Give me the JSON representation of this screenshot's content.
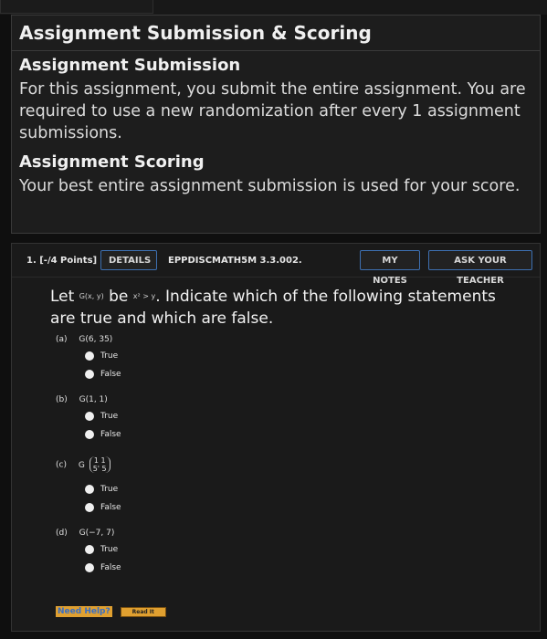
{
  "panel": {
    "title": "Assignment Submission & Scoring",
    "submission_heading": "Assignment Submission",
    "submission_text": "For this assignment, you submit the entire assignment. You are required to use a new randomization after every 1 assignment submissions.",
    "scoring_heading": "Assignment Scoring",
    "scoring_text": "Your best entire assignment submission is used for your score."
  },
  "question": {
    "number": "1. [-/4 Points]",
    "details_label": "DETAILS",
    "code": "EPPDISCMATH5M 3.3.002.",
    "notes_label": "MY NOTES",
    "ask_label": "ASK YOUR TEACHER",
    "stem_let": "Let",
    "stem_gxy": "G(x, y)",
    "stem_be": "be",
    "stem_cond": "x² > y",
    "stem_rest": ". Indicate which of the following statements are true and which are false.",
    "parts": [
      {
        "label": "(a)",
        "expr": "G(6, 35)"
      },
      {
        "label": "(b)",
        "expr": "G(1, 1)"
      },
      {
        "label": "(c)",
        "expr_prefix": "G",
        "m_top": "1  1",
        "m_bottom": "5' 5"
      },
      {
        "label": "(d)",
        "expr": "G(−7, 7)"
      }
    ],
    "true_label": "True",
    "false_label": "False",
    "need_help": "Need Help?",
    "read_it": "Read It"
  }
}
